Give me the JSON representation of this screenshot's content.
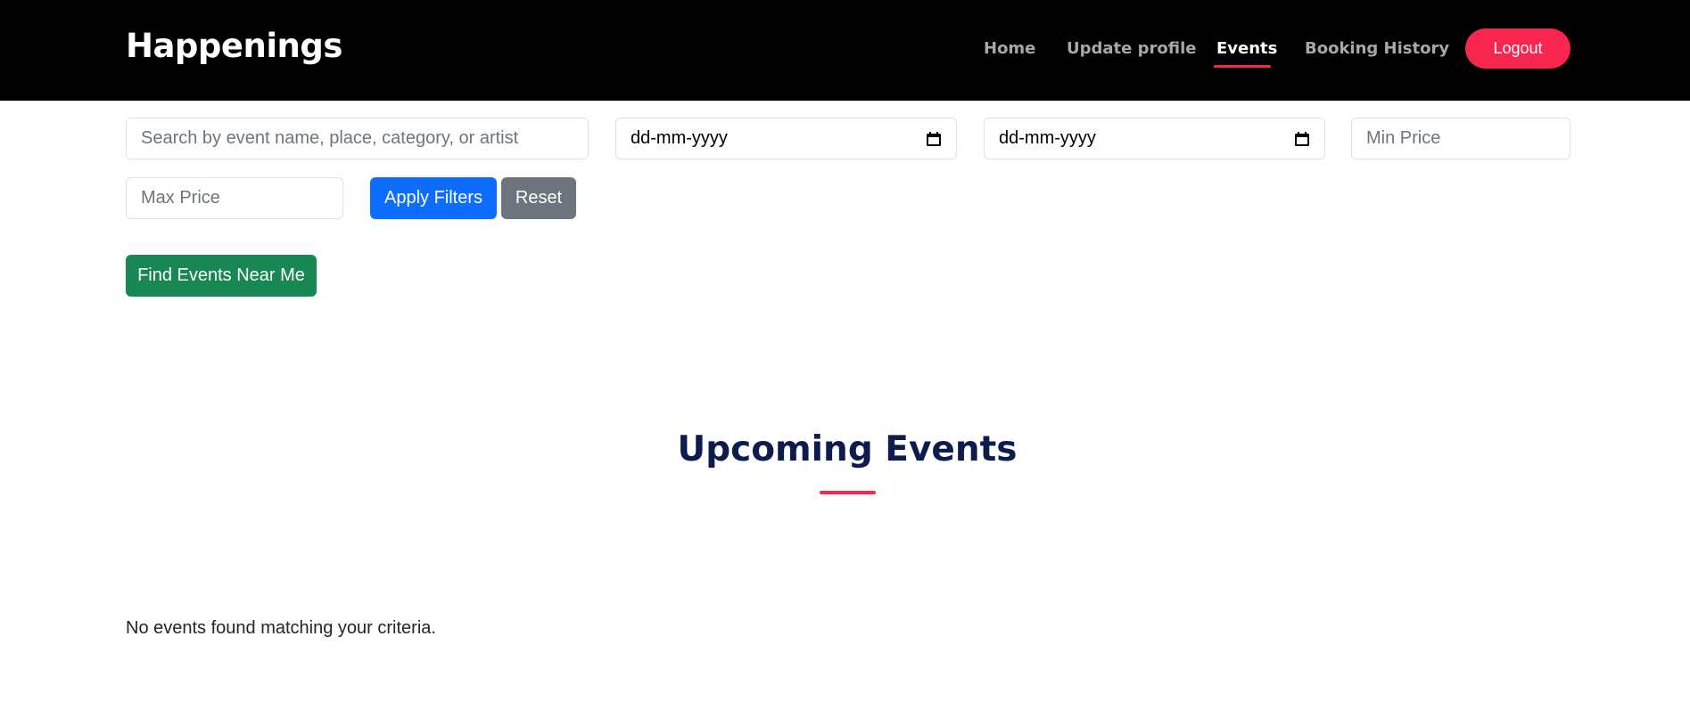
{
  "header": {
    "brand": "Happenings",
    "nav": {
      "home": "Home",
      "update_profile": "Update profile",
      "events": "Events",
      "booking_history": "Booking History"
    },
    "active_nav": "Events",
    "logout_label": "Logout"
  },
  "filters": {
    "search_placeholder": "Search by event name, place, category, or artist",
    "start_date_value": "dd-mm-yyyy",
    "end_date_value": "dd-mm-yyyy",
    "min_price_placeholder": "Min Price",
    "max_price_placeholder": "Max Price",
    "apply_label": "Apply Filters",
    "reset_label": "Reset",
    "near_me_label": "Find Events Near Me"
  },
  "main": {
    "title": "Upcoming Events",
    "empty_message": "No events found matching your criteria."
  },
  "colors": {
    "accent": "#f8264f",
    "navbar_bg": "#000000",
    "title": "#0e1b4d",
    "primary": "#0d6efd",
    "secondary": "#6c757d",
    "success": "#198754"
  },
  "icons": {
    "date_picker": "calendar-icon"
  }
}
